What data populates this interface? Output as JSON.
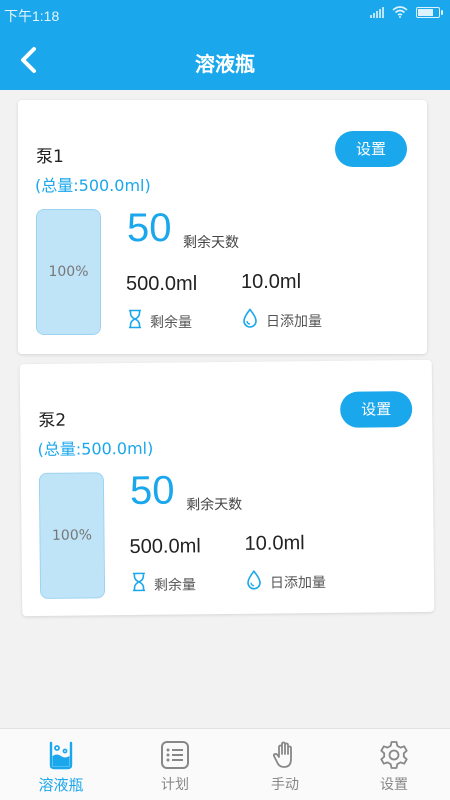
{
  "status_bar": {
    "time": "下午1:18"
  },
  "header": {
    "title": "溶液瓶",
    "back_icon": "chevron-left-icon"
  },
  "pumps": [
    {
      "name": "泵1",
      "total": "(总量:500.0ml)",
      "setting_label": "设置",
      "fill_percent": 100,
      "fill_label": "100%",
      "remaining_days": "50",
      "remaining_days_label": "剩余天数",
      "remaining_volume": "500.0ml",
      "remaining_volume_label": "剩余量",
      "daily_add": "10.0ml",
      "daily_add_label": "日添加量"
    },
    {
      "name": "泵2",
      "total": "(总量:500.0ml)",
      "setting_label": "设置",
      "fill_percent": 100,
      "fill_label": "100%",
      "remaining_days": "50",
      "remaining_days_label": "剩余天数",
      "remaining_volume": "500.0ml",
      "remaining_volume_label": "剩余量",
      "daily_add": "10.0ml",
      "daily_add_label": "日添加量"
    }
  ],
  "tabs": [
    {
      "label": "溶液瓶",
      "icon": "bottle-icon",
      "active": true
    },
    {
      "label": "计划",
      "icon": "list-icon",
      "active": false
    },
    {
      "label": "手动",
      "icon": "hand-icon",
      "active": false
    },
    {
      "label": "设置",
      "icon": "gear-icon",
      "active": false
    }
  ],
  "colors": {
    "accent": "#1aa7ec",
    "bottle_fill": "#bfe4f8",
    "background": "#f2f2f2"
  }
}
